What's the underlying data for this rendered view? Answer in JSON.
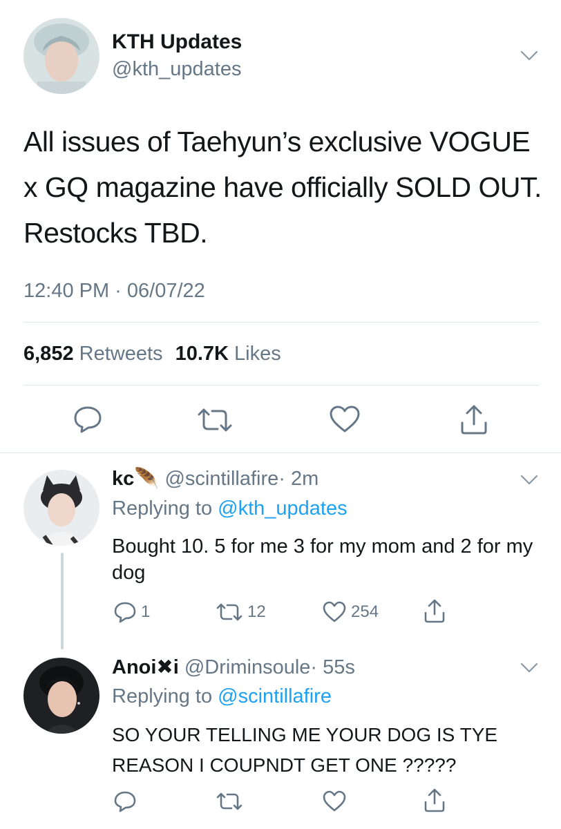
{
  "main_tweet": {
    "author_name": "KTH Updates",
    "author_handle": "@kth_updates",
    "text": "All issues of Taehyun’s exclusive VOGUE x GQ magazine have officially SOLD OUT. Restocks TBD.",
    "timestamp": "12:40 PM · 06/07/22",
    "retweets_count": "6,852",
    "retweets_label": "Retweets",
    "likes_count": "10.7K",
    "likes_label": "Likes"
  },
  "replies": [
    {
      "author_name": "kc",
      "author_emoji": "🪶",
      "author_handle": "@scintillafire",
      "time": "· 2m",
      "replying_label": "Replying to",
      "replying_to": "@kth_updates",
      "text": "Bought 10. 5 for me 3 for my mom and 2 for my dog",
      "reply_count": "1",
      "retweet_count": "12",
      "like_count": "254"
    },
    {
      "author_name": "Anoi✖i",
      "author_handle": "@Driminsoule",
      "time": "· 55s",
      "replying_label": "Replying to",
      "replying_to": "@scintillafire",
      "text": "SO YOUR TELLING ME YOUR DOG IS TYE REASON I COUPNDT GET ONE ?????"
    }
  ],
  "colors": {
    "text": "#14171a",
    "muted": "#657786",
    "link": "#1da1f2",
    "divider": "#e1e8ed"
  },
  "icons": [
    "chevron-down-icon",
    "reply-icon",
    "retweet-icon",
    "like-icon",
    "share-icon"
  ]
}
